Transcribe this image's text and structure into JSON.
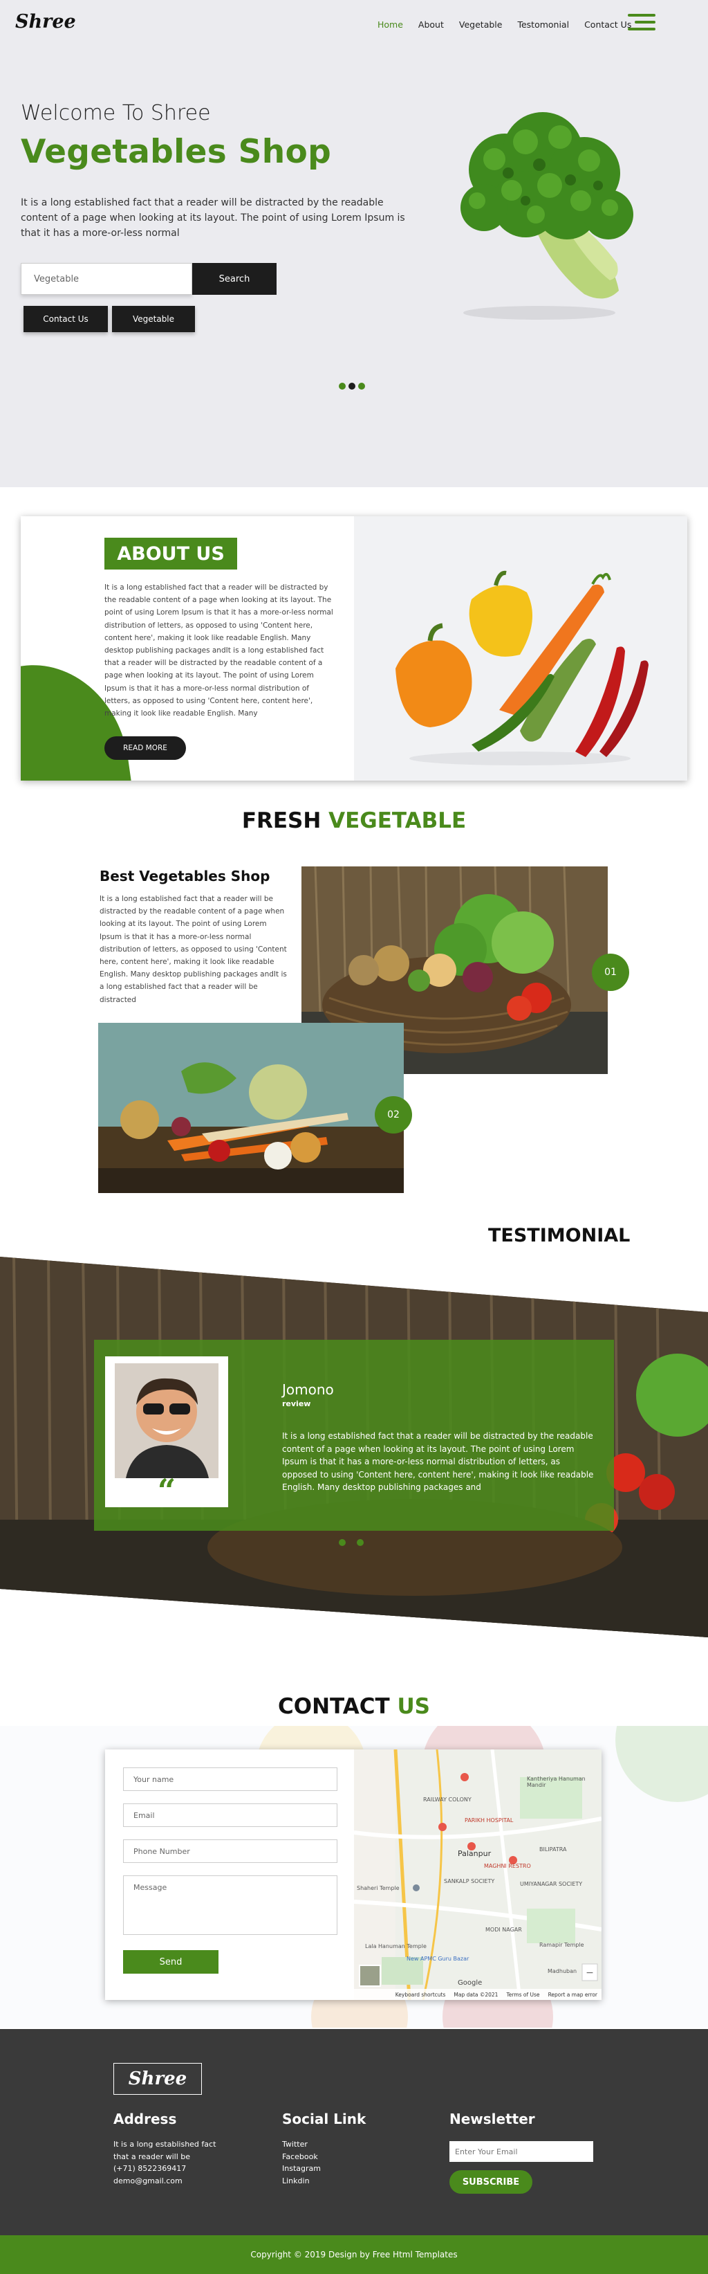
{
  "brand": {
    "logo": "Shree"
  },
  "nav": {
    "items": [
      "Home",
      "About",
      "Vegetable",
      "Testomonial",
      "Contact Us"
    ],
    "active": "Home"
  },
  "hero": {
    "welcome": "Welcome To Shree",
    "title": "Vegetables Shop",
    "text": "It is a long established fact that a reader will be distracted by the readable content of a page when looking at its layout. The point of using Lorem Ipsum is that it has a more-or-less normal",
    "search_placeholder": "Vegetable",
    "search_button": "Search",
    "btn_contact": "Contact Us",
    "btn_vegetable": "Vegetable"
  },
  "about": {
    "heading": "ABOUT US",
    "text": "It is a long established fact that a reader will be distracted by the readable content of a page when looking at its layout. The point of using Lorem Ipsum is that it has a more-or-less normal distribution of letters, as opposed to using 'Content here, content here', making it look like readable English. Many desktop publishing packages andIt is a long established fact that a reader will be distracted by the readable content of a page when looking at its layout. The point of using Lorem Ipsum is that it has a more-or-less normal distribution of letters, as opposed to using 'Content here, content here', making it look like readable English. Many",
    "read_more": "READ MORE"
  },
  "fresh": {
    "title_a": "FRESH",
    "title_b": "VEGETABLE",
    "best_title": "Best Vegetables Shop",
    "best_text": "It is a long established fact that a reader will be distracted by the readable content of a page when looking at its layout. The point of using Lorem Ipsum is that it has a more-or-less normal distribution of letters, as opposed to using 'Content here, content here', making it look like readable English. Many desktop publishing packages andIt is a long established fact that a reader will be distracted",
    "badge1": "01",
    "badge2": "02"
  },
  "testimonial": {
    "title": "TESTIMONIAL",
    "name": "Jomono",
    "role": "review",
    "text": "It is a long established fact that a reader will be distracted by the readable content of a page when looking at its layout. The point of using Lorem Ipsum is that it has a more-or-less normal distribution of letters, as opposed to using 'Content here, content here', making it look like readable English. Many desktop publishing packages and",
    "quote_icon": "quote-icon"
  },
  "contact": {
    "title_a": "CONTACT",
    "title_b": "US",
    "name_placeholder": "Your name",
    "email_placeholder": "Email",
    "phone_placeholder": "Phone Number",
    "message_placeholder": "Message",
    "send": "Send",
    "map": {
      "labels": [
        "RAILWAY COLONY",
        "Palanpur",
        "BILIPATRA",
        "MODI NAGAR",
        "UMIYANAGAR SOCIETY",
        "Ramapir Temple",
        "Madhuban",
        "Kantheriya Hanuman Mandir",
        "New APMC Guru Bazar",
        "Lala Hanuman Temple",
        "PARIKH HOSPITAL",
        "MAGHNI RESTRO",
        "Shaheri Temple",
        "SANKALP SOCIETY"
      ],
      "footer": [
        "Keyboard shortcuts",
        "Map data ©2021",
        "Terms of Use",
        "Report a map error"
      ],
      "google": "Google"
    }
  },
  "footer": {
    "logo": "Shree",
    "address_title": "Address",
    "address_lines": [
      "It is a long established fact",
      "that a reader will be",
      "(+71) 8522369417",
      "demo@gmail.com"
    ],
    "social_title": "Social Link",
    "social_links": [
      "Twitter",
      "Facebook",
      "Instagram",
      "Linkdin"
    ],
    "newsletter_title": "Newsletter",
    "newsletter_placeholder": "Enter Your Email",
    "subscribe": "SUBSCRIBE",
    "copyright": "Copyright © 2019 Design by Free Html Templates"
  },
  "colors": {
    "accent": "#4a8a1c",
    "dark": "#1d1d1d",
    "footer": "#3a3a3a",
    "hero_bg": "#ebebef"
  }
}
